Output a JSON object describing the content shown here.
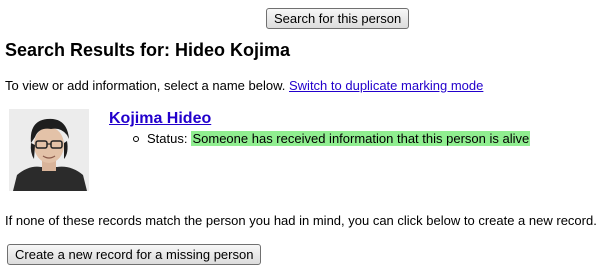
{
  "search_button": {
    "label": "Search for this person"
  },
  "results": {
    "heading": "Search Results for: Hideo Kojima",
    "intro_text": "To view or add information, select a name below.",
    "duplicate_link": "Switch to duplicate marking mode"
  },
  "person": {
    "name": "Kojima Hideo",
    "status_label": "Status:",
    "status_value": "Someone has received information that this person is alive",
    "status_color": "#90ee90"
  },
  "footer": {
    "text": "If none of these records match the person you had in mind, you can click below to create a new record.",
    "create_button": "Create a new record for a missing person"
  }
}
